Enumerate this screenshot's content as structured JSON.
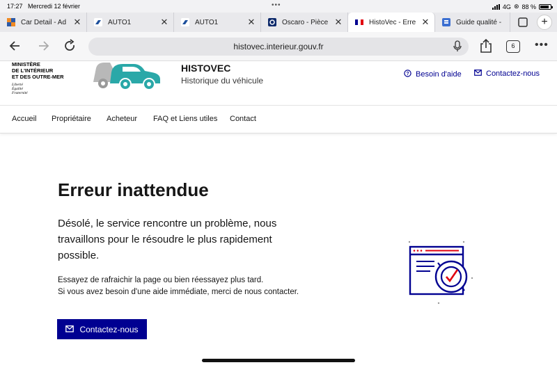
{
  "status_bar": {
    "time": "17:27",
    "date": "Mercredi 12 février",
    "network": "4G",
    "battery": "88 %",
    "battery_level": 0.88
  },
  "tabs": [
    {
      "title": "Car Detail - Ad",
      "icon": "orange-grid-icon"
    },
    {
      "title": "AUTO1",
      "icon": "auto1-icon"
    },
    {
      "title": "AUTO1",
      "icon": "auto1-icon"
    },
    {
      "title": "Oscaro - Pièce",
      "icon": "oscaro-icon"
    },
    {
      "title": "HistoVec - Erre",
      "icon": "french-flag-icon",
      "active": true
    },
    {
      "title": "Guide qualité -",
      "icon": "guide-icon"
    }
  ],
  "browser": {
    "url": "histovec.interieur.gouv.fr",
    "tab_count": "6"
  },
  "header": {
    "ministry_line1": "MINISTÈRE",
    "ministry_line2": "DE L'INTÉRIEUR",
    "ministry_line3": "ET DES OUTRE-MER",
    "devise_1": "Liberté",
    "devise_2": "Égalité",
    "devise_3": "Fraternité",
    "site_title": "HISTOVEC",
    "site_subtitle": "Historique du véhicule",
    "help_link": "Besoin d'aide",
    "contact_link": "Contactez-nous"
  },
  "nav": [
    "Accueil",
    "Propriétaire",
    "Acheteur",
    "FAQ et Liens utiles",
    "Contact"
  ],
  "main": {
    "title": "Erreur inattendue",
    "lead": "Désolé, le service rencontre un problème, nous travaillons pour le résoudre le plus rapidement possible.",
    "hint_line1": "Essayez de rafraichir la page ou bien réessayez plus tard.",
    "hint_line2": "Si vous avez besoin d'une aide immédiate, merci de nous contacter.",
    "button": "Contactez-nous"
  },
  "colors": {
    "primary": "#000091",
    "accent_red": "#e1000f",
    "teal": "#2aa8a8"
  }
}
